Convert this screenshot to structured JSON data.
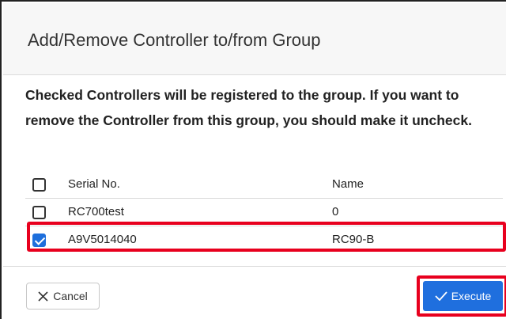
{
  "dialog": {
    "title": "Add/Remove Controller to/from Group",
    "message": "Checked Controllers will be registered to the group. If you want to remove the Controller from this group, you should make it uncheck."
  },
  "table": {
    "columns": [
      "Serial No.",
      "Name"
    ],
    "rows": [
      {
        "serial": "RC700test",
        "name": "0",
        "checked": false
      },
      {
        "serial": "A9V5014040",
        "name": "RC90-B",
        "checked": true
      }
    ]
  },
  "buttons": {
    "cancel_label": "Cancel",
    "execute_label": "Execute"
  },
  "icons": {
    "cancel": "close-icon",
    "execute": "check-icon"
  },
  "colors": {
    "primary": "#1f6fde",
    "highlight": "#e8001e"
  }
}
